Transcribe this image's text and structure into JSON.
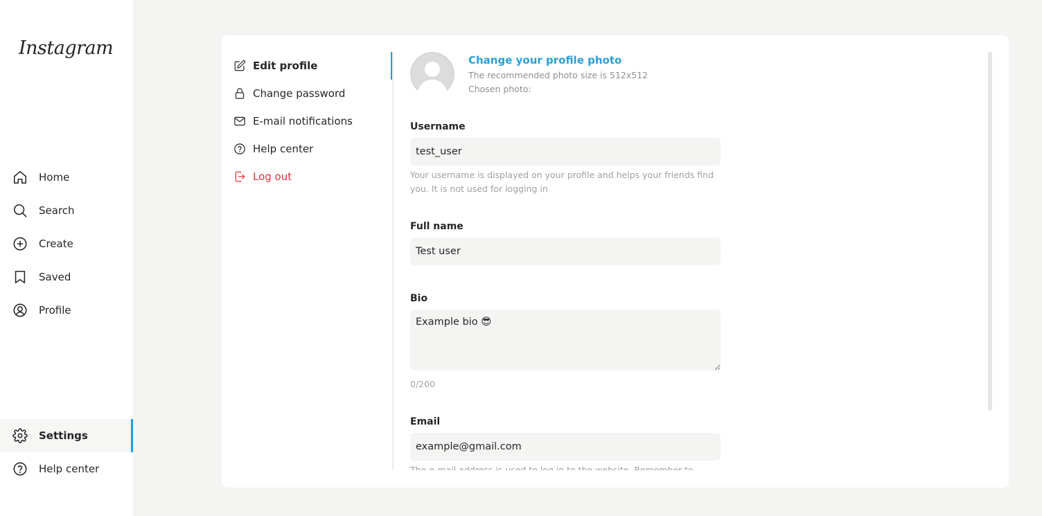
{
  "brand": {
    "logo_text": "Instagram"
  },
  "sidebar": {
    "items": [
      {
        "label": "Home",
        "icon": "home-icon"
      },
      {
        "label": "Search",
        "icon": "search-icon"
      },
      {
        "label": "Create",
        "icon": "plus-circle-icon"
      },
      {
        "label": "Saved",
        "icon": "bookmark-icon"
      },
      {
        "label": "Profile",
        "icon": "user-circle-icon"
      }
    ],
    "bottom_items": [
      {
        "label": "Settings",
        "icon": "gear-icon",
        "active": true
      },
      {
        "label": "Help center",
        "icon": "help-circle-icon"
      }
    ]
  },
  "settings_menu": {
    "items": [
      {
        "label": "Edit profile",
        "icon": "pencil-icon",
        "active": true
      },
      {
        "label": "Change password",
        "icon": "lock-icon"
      },
      {
        "label": "E-mail notifications",
        "icon": "envelope-icon"
      },
      {
        "label": "Help center",
        "icon": "help-circle-icon"
      },
      {
        "label": "Log out",
        "icon": "logout-icon"
      }
    ]
  },
  "profile_photo": {
    "title": "Change your profile photo",
    "recommendation": "The recommended photo size is 512x512",
    "chosen_label": "Chosen photo:"
  },
  "form": {
    "username": {
      "label": "Username",
      "value": "test_user",
      "hint": "Your username is displayed on your profile and helps your friends find you. It is not used for logging in"
    },
    "full_name": {
      "label": "Full name",
      "value": "Test user"
    },
    "bio": {
      "label": "Bio",
      "value": "Example bio 😎",
      "counter": "0/200"
    },
    "email": {
      "label": "Email",
      "value": "example@gmail.com",
      "hint": "The e-mail address is used to log in to the website. Remember to"
    }
  },
  "colors": {
    "accent": "#1e9de0",
    "link": "#2a9fd8",
    "danger": "#e0313c",
    "input_bg": "#f4f4f3"
  }
}
